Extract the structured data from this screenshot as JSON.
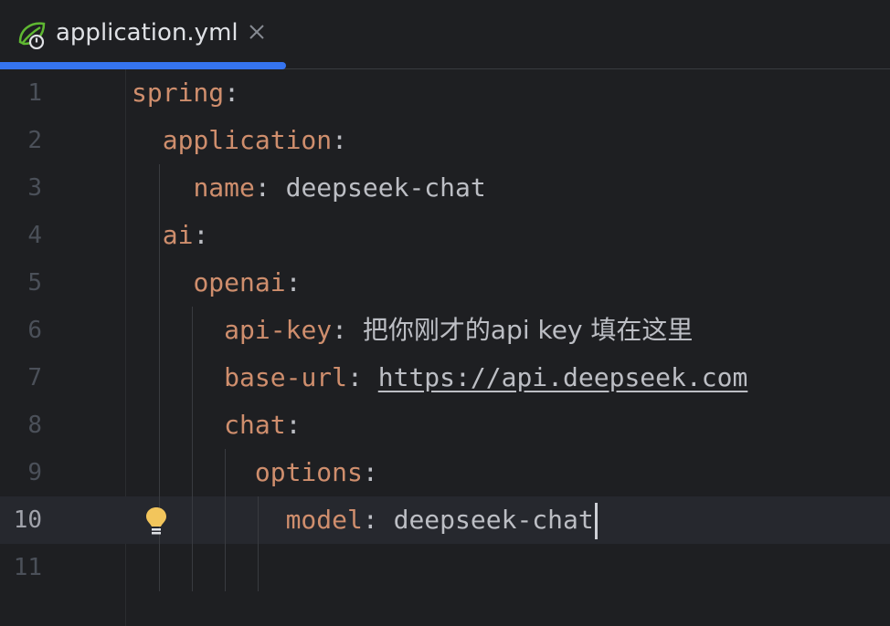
{
  "tab": {
    "filename": "application.yml",
    "icon": "spring-leaf-icon",
    "close_icon": "close-icon",
    "accent_color": "#3574f0"
  },
  "editor": {
    "current_line": 10,
    "lines": [
      {
        "n": "1",
        "indent": "",
        "key": "spring",
        "sep": ":",
        "value": "",
        "value_kind": "none"
      },
      {
        "n": "2",
        "indent": "  ",
        "key": "application",
        "sep": ":",
        "value": "",
        "value_kind": "none"
      },
      {
        "n": "3",
        "indent": "    ",
        "key": "name",
        "sep": ": ",
        "value": "deepseek-chat",
        "value_kind": "text"
      },
      {
        "n": "4",
        "indent": "  ",
        "key": "ai",
        "sep": ":",
        "value": "",
        "value_kind": "none"
      },
      {
        "n": "5",
        "indent": "    ",
        "key": "openai",
        "sep": ":",
        "value": "",
        "value_kind": "none"
      },
      {
        "n": "6",
        "indent": "      ",
        "key": "api-key",
        "sep": ": ",
        "value": "把你刚才的api key 填在这里",
        "value_kind": "text"
      },
      {
        "n": "7",
        "indent": "      ",
        "key": "base-url",
        "sep": ": ",
        "value": "https://api.deepseek.com",
        "value_kind": "link"
      },
      {
        "n": "8",
        "indent": "      ",
        "key": "chat",
        "sep": ":",
        "value": "",
        "value_kind": "none"
      },
      {
        "n": "9",
        "indent": "        ",
        "key": "options",
        "sep": ":",
        "value": "",
        "value_kind": "none"
      },
      {
        "n": "10",
        "indent": "          ",
        "key": "model",
        "sep": ": ",
        "value": "deepseek-chat",
        "value_kind": "text"
      },
      {
        "n": "11",
        "indent": "",
        "key": "",
        "sep": "",
        "value": "",
        "value_kind": "none"
      }
    ],
    "intention_icon": "lightbulb-icon",
    "colors": {
      "background": "#1e1f22",
      "key": "#cf8e6d",
      "text": "#bcbec4",
      "line_number": "#4b5059",
      "current_line_bg": "#26282e"
    }
  }
}
